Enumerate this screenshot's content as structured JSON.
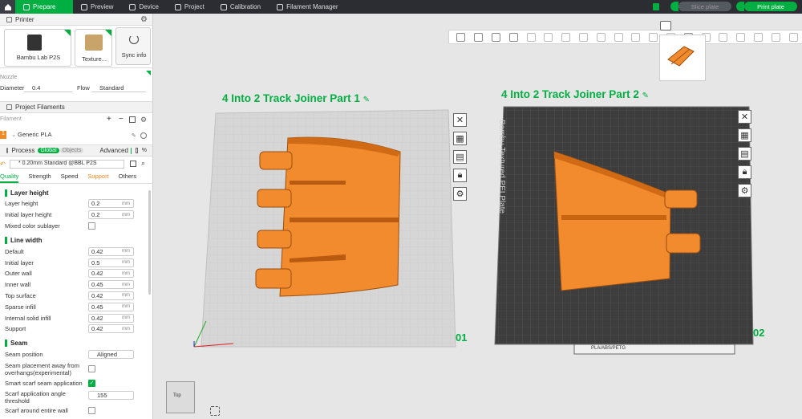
{
  "topbar": {
    "tabs": [
      {
        "label": "Prepare",
        "icon": "prepare-icon"
      },
      {
        "label": "Preview",
        "icon": "preview-icon"
      },
      {
        "label": "Device",
        "icon": "device-icon"
      },
      {
        "label": "Project",
        "icon": "project-icon"
      },
      {
        "label": "Calibration",
        "icon": "calibration-icon"
      },
      {
        "label": "Filament Manager",
        "icon": "filament-manager-icon"
      }
    ],
    "slice_label": "Slice plate",
    "print_label": "Print plate"
  },
  "printer": {
    "header": "Printer",
    "printer_name": "Bambu Lab P2S",
    "plate_type": "Texture...",
    "sync_label": "Sync info",
    "nozzle_header": "Nozzle",
    "diameter_label": "Diameter",
    "diameter_value": "0.4",
    "flow_label": "Flow",
    "flow_value": "Standard"
  },
  "filaments": {
    "header": "Project Filaments",
    "col_label": "Filament",
    "items": [
      {
        "index": "1",
        "name": "Generic PLA",
        "color": "#f08a24"
      }
    ]
  },
  "process": {
    "header": "Process",
    "global_label": "Global",
    "objects_label": "Objects",
    "advanced_label": "Advanced",
    "preset": "* 0.20mm Standard @BBL P2S",
    "tabs": [
      "Quality",
      "Strength",
      "Speed",
      "Support",
      "Others"
    ],
    "groups": [
      {
        "title": "Layer height",
        "rows": [
          {
            "label": "Layer height",
            "value": "0.2",
            "unit": "mm"
          },
          {
            "label": "Initial layer height",
            "value": "0.2",
            "unit": "mm"
          },
          {
            "label": "Mixed color sublayer",
            "checkbox": false
          }
        ]
      },
      {
        "title": "Line width",
        "rows": [
          {
            "label": "Default",
            "value": "0.42",
            "unit": "mm"
          },
          {
            "label": "Initial layer",
            "value": "0.5",
            "unit": "mm"
          },
          {
            "label": "Outer wall",
            "value": "0.42",
            "unit": "mm"
          },
          {
            "label": "Inner wall",
            "value": "0.45",
            "unit": "mm"
          },
          {
            "label": "Top surface",
            "value": "0.42",
            "unit": "mm"
          },
          {
            "label": "Sparse infill",
            "value": "0.45",
            "unit": "mm"
          },
          {
            "label": "Internal solid infill",
            "value": "0.42",
            "unit": "mm"
          },
          {
            "label": "Support",
            "value": "0.42",
            "unit": "mm"
          }
        ]
      },
      {
        "title": "Seam",
        "rows": [
          {
            "label": "Seam position",
            "value": "Aligned"
          },
          {
            "label": "Seam placement away from overhangs(experimental)",
            "checkbox": false
          },
          {
            "label": "Smart scarf seam application",
            "checkbox": true
          },
          {
            "label": "Scarf application angle threshold",
            "value": "155"
          },
          {
            "label": "Scarf around entire wall",
            "checkbox": false
          }
        ]
      }
    ]
  },
  "viewport": {
    "plate1_title": "4 Into 2 Track Joiner Part 1",
    "plate1_num": "01",
    "plate2_title": "4 Into 2 Track Joiner Part 2",
    "plate2_num": "02",
    "plate2_bed_label": "Bambu Textured PEI Plate",
    "plate2_label_strip": "PLA/ABS/PETG",
    "navcube_label": "Top",
    "model_color": "#f28a2e"
  }
}
